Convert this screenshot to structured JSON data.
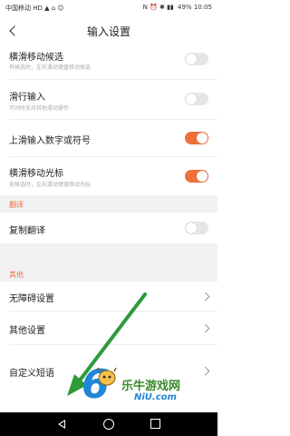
{
  "status_bar": {
    "carrier": "中国移动",
    "carrier_icons": "HD ▲ ⌂ ☺",
    "signal_icons": "N ⏰ ✱ ▮▮",
    "battery": "49%",
    "time": "10:05"
  },
  "header": {
    "title": "输入设置"
  },
  "settings": {
    "horizontal_candidate": {
      "label": "横滑移动候选",
      "sub": "有候选时，左右滑动键盘移动候选",
      "enabled": false
    },
    "swipe_input": {
      "label": "滑行输入",
      "sub": "不同时支持其他滑动操作",
      "enabled": false
    },
    "swipe_up_numbers": {
      "label": "上滑输入数字或符号",
      "enabled": true
    },
    "horizontal_cursor": {
      "label": "横滑移动光标",
      "sub": "无候选时，左右滑动键盘移动光标",
      "enabled": true
    }
  },
  "translation_section": {
    "header": "翻译",
    "copy_translate": {
      "label": "复制翻译",
      "enabled": false
    }
  },
  "other_section": {
    "header": "其他",
    "items": [
      {
        "label": "无障碍设置"
      },
      {
        "label": "其他设置"
      },
      {
        "label": "自定义短语"
      }
    ]
  },
  "watermark": {
    "brand": "乐牛游戏网",
    "url": "NiU.com"
  },
  "colors": {
    "accent": "#f0703a",
    "toggle_off": "#e6e6e6",
    "section_bg": "#f2f2f2",
    "arrow": "#2e9a3a"
  }
}
